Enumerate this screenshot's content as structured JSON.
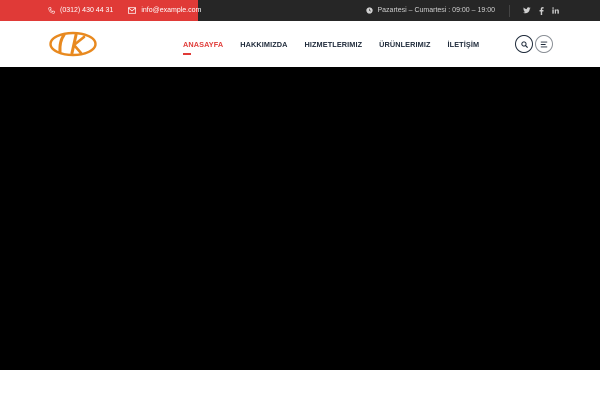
{
  "topbar": {
    "phone": "(0312) 430 44 31",
    "email": "info@example.com",
    "hours": "Pazartesi – Cumartesi : 09:00 – 19:00",
    "social": [
      {
        "name": "twitter-icon",
        "glyph": "t"
      },
      {
        "name": "facebook-icon",
        "glyph": "f"
      },
      {
        "name": "linkedin-icon",
        "glyph": "in"
      }
    ]
  },
  "header": {
    "logo_text": "DK",
    "nav": [
      "ANASAYFA",
      "HAKKIMIZDA",
      "HIZMETLERIMIZ",
      "ÜRÜNLERIMIZ",
      "İLETİŞİM"
    ],
    "active_nav": "ANASAYFA"
  },
  "colors": {
    "accent": "#e03a37",
    "topbar_bg": "#262626",
    "nav_text": "#1e2a3a",
    "logo_orange": "#e8891f",
    "hero_bg": "#000000"
  }
}
